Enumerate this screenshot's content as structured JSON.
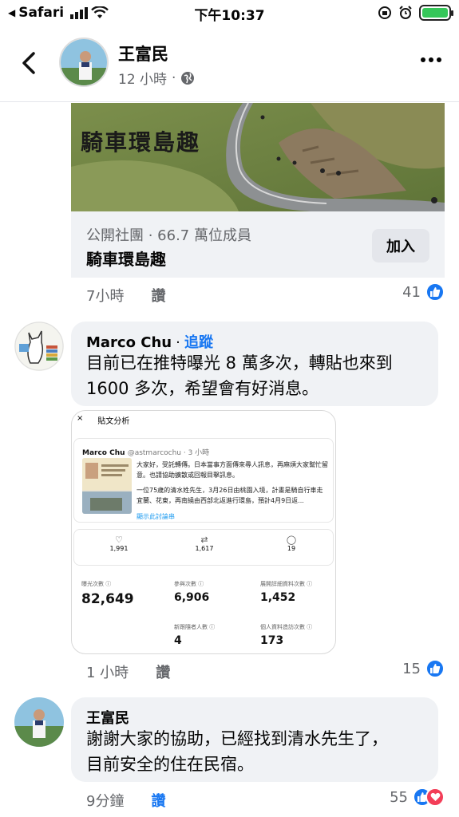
{
  "status_bar": {
    "back_app": "Safari",
    "time": "下午10:37"
  },
  "header": {
    "name": "王富民",
    "time_ago": "12 小時",
    "separator": "·"
  },
  "group_card": {
    "image_title": "騎車環島趣",
    "meta": "公開社團 · 66.7 萬位成員",
    "name": "騎車環島趣",
    "join_label": "加入"
  },
  "post_actions": {
    "time": "7小時",
    "like": "讚",
    "count": "41"
  },
  "comment1": {
    "author": "Marco Chu",
    "separator": "·",
    "follow": "追蹤",
    "text_line1": "目前已在推特曝光 8 萬多次，轉貼也來到",
    "text_line2": "1600 多次，希望會有好消息。",
    "time": "1 小時",
    "like": "讚",
    "count": "15"
  },
  "tweet_shot": {
    "close": "×",
    "title": "貼文分析",
    "user": "Marco Chu",
    "handle": "@astmarcochu · 3 小時",
    "text1": "大家好，受託轉傳。日本當事方面傳來尋人訊息，再麻煩大家幫忙留意。也請協助擴散或回報目擊訊息。",
    "text2": "一位75歲的清水姓先生，3月26日由桃園入境，計畫是騎自行車走宜蘭、花東，再南繞由西部北返進行環島，預計4月9日返...",
    "show_more": "顯示此討論串",
    "likes": "1,991",
    "retweets": "1,617",
    "replies": "19",
    "impressions_label": "曝光次數 ⓘ",
    "impressions": "82,649",
    "engagements_label": "參與次數 ⓘ",
    "engagements": "6,906",
    "detail_label": "展開詳細資料次數 ⓘ",
    "detail": "1,452",
    "followers_label": "新跟隨者人數 ⓘ",
    "followers": "4",
    "profile_label": "個人資料造訪次數 ⓘ",
    "profile": "173"
  },
  "comment2": {
    "author": "王富民",
    "text_line1": "謝謝大家的協助，已經找到清水先生了，",
    "text_line2": "目前安全的住在民宿。",
    "time": "9分鐘",
    "like": "讚",
    "count": "55"
  },
  "colors": {
    "facebook_blue": "#1877f2",
    "bubble_gray": "#f0f2f5",
    "secondary_text": "#65676b",
    "heart_red": "#f33e58"
  },
  "icons": [
    "back-chevron-icon",
    "globe-icon",
    "more-icon",
    "like-reaction-icon",
    "heart-reaction-icon"
  ]
}
